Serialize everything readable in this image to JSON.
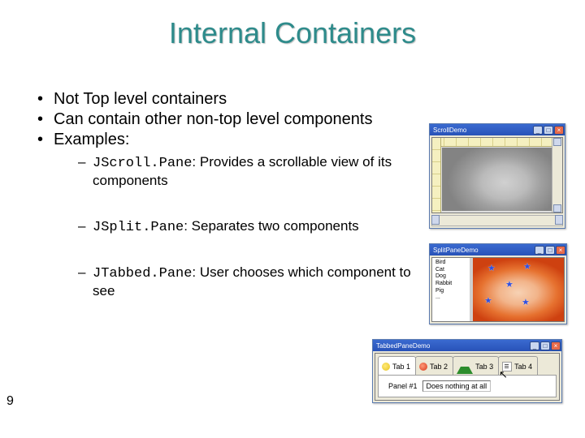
{
  "title": "Internal Containers",
  "page_number": "9",
  "bullets": {
    "b1": "Not Top level containers",
    "b2": "Can contain other non-top level components",
    "b3": "Examples:"
  },
  "examples": {
    "e1": {
      "code": "JScroll.Pane",
      "desc": ": Provides a scrollable view of its components"
    },
    "e2": {
      "code": "JSplit.Pane",
      "desc": ": Separates two components"
    },
    "e3": {
      "code": "JTabbed.Pane",
      "desc": ": User chooses which component to see"
    }
  },
  "scroll_window": {
    "title": "ScrollDemo"
  },
  "split_window": {
    "title": "SplitPaneDemo",
    "left_text": "Bird\nCat\nDog\nRabbit\nPig\n..."
  },
  "tabbed_window": {
    "title": "TabbedPaneDemo",
    "tabs": {
      "t1": "Tab 1",
      "t2": "Tab 2",
      "t3": "Tab 3",
      "t4": "Tab 4"
    },
    "panel_label": "Panel #1",
    "panel_field": "Does nothing at all"
  }
}
